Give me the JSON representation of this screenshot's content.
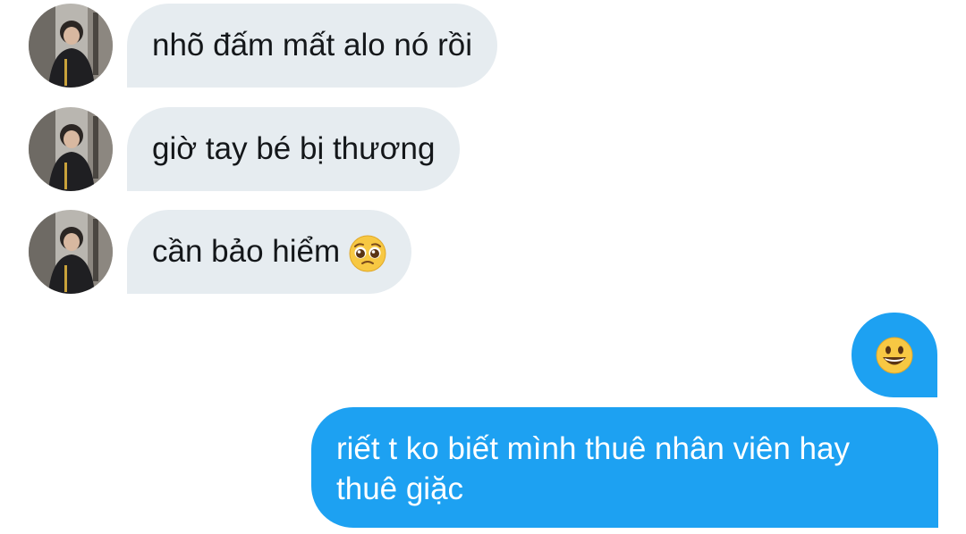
{
  "conversation": {
    "messages": [
      {
        "sender": "them",
        "text": "nhõ đấm mất alo nó rồi"
      },
      {
        "sender": "them",
        "text": "giờ tay bé bị thương"
      },
      {
        "sender": "them",
        "text": "cần bảo hiểm",
        "emoji": "pleading-face"
      },
      {
        "sender": "me",
        "emoji": "grinning-face"
      },
      {
        "sender": "me",
        "text": "riết t ko biết mình thuê nhân viên hay thuê giặc"
      }
    ]
  },
  "colors": {
    "incoming_bubble": "#e6ecf0",
    "outgoing_bubble": "#1da1f2",
    "incoming_text": "#14171a",
    "outgoing_text": "#ffffff"
  },
  "icons": {
    "avatar": "user-photo-avatar",
    "emoji_1": "pleading-face-emoji",
    "emoji_2": "grinning-face-emoji"
  }
}
